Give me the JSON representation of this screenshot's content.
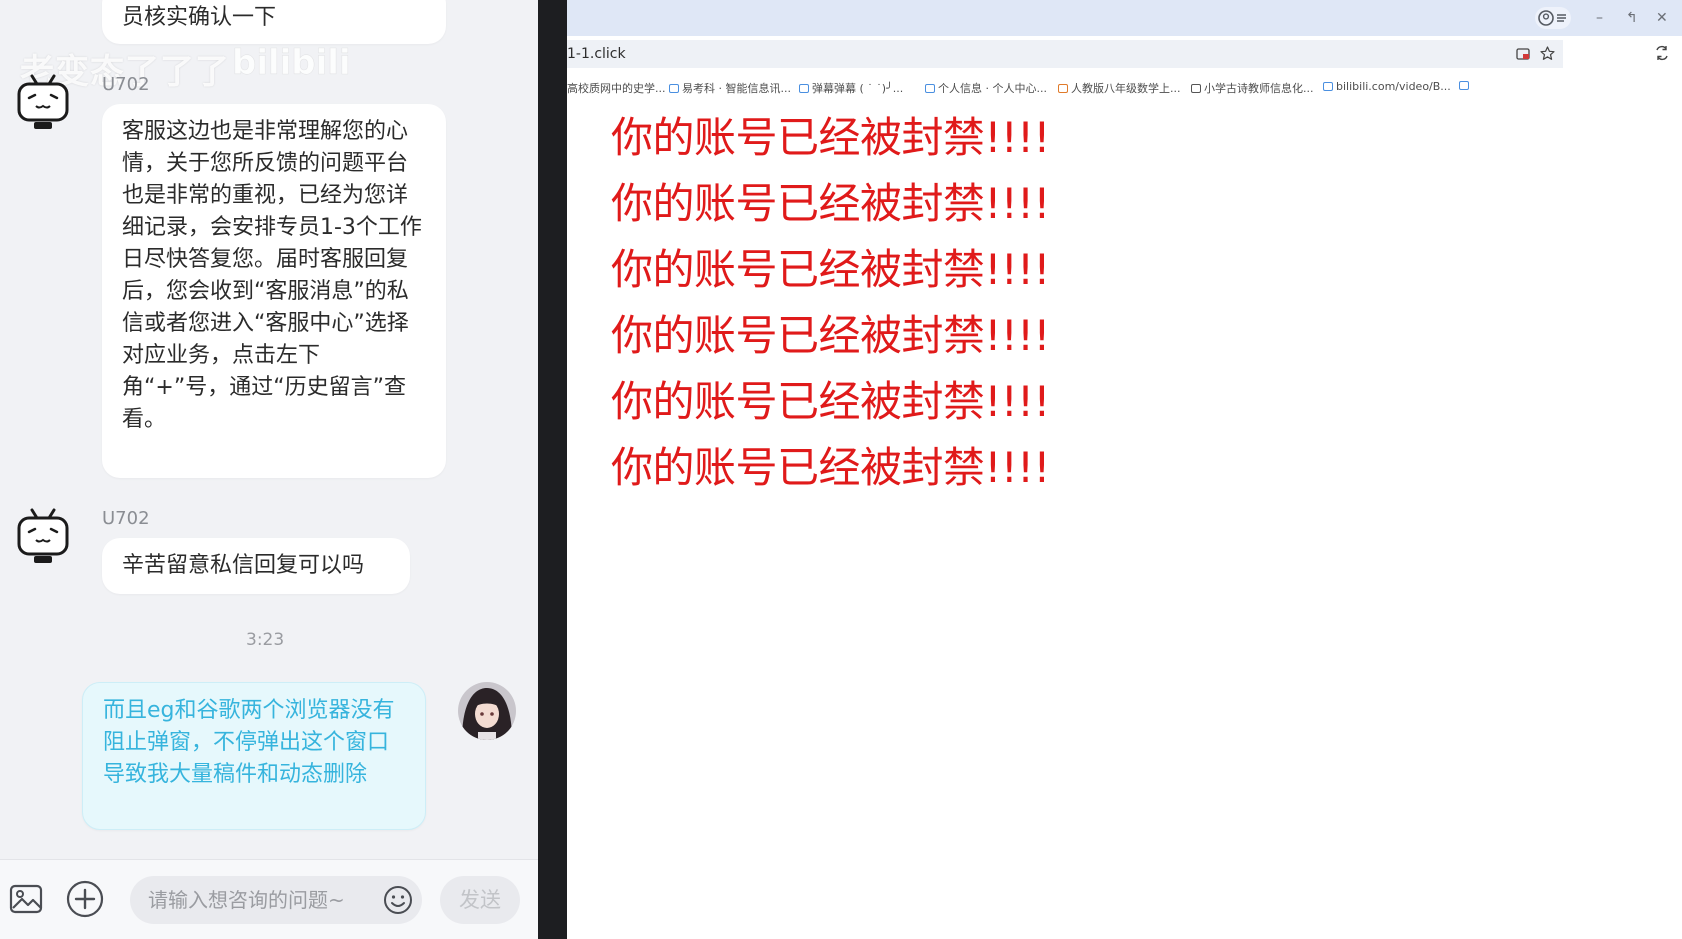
{
  "chat": {
    "watermark_text": "老变态了了了",
    "watermark_logo_text": "bilibili",
    "first_bubble_text": "员核实确认一下",
    "messages": [
      {
        "user": "U702",
        "text": "客服这边也是非常理解您的心情，关于您所反馈的问题平台也是非常的重视，已经为您详细记录，会安排专员1-3个工作日尽快答复您。届时客服回复后，您会收到“客服消息”的私信或者您进入“客服中心”选择对应业务，点击左下角“+”号，通过“历史留言”查看。"
      },
      {
        "user": "U702",
        "text": "辛苦留意私信回复可以吗"
      }
    ],
    "timestamp": "3:23",
    "my_message": "而且eg和谷歌两个浏览器没有阻止弹窗，不停弹出这个窗口导致我大量稿件和动态删除",
    "input_placeholder": "请输入想咨询的问题~",
    "send_label": "发送"
  },
  "browser": {
    "url": "1-1.click",
    "bookmarks": [
      "高校质网中的史学...",
      "易考科 · 智能信息讯...",
      "弹幕弹幕 ( ˙ ˙)╯...",
      "个人信息 · 个人中心...",
      "人教版八年级数学上...",
      "小学古诗教师信息化...",
      "bilibili.com/video/B..."
    ],
    "alert_lines": [
      "你的账号已经被封禁!!!!",
      "你的账号已经被封禁!!!!",
      "你的账号已经被封禁!!!!",
      "你的账号已经被封禁!!!!",
      "你的账号已经被封禁!!!!",
      "你的账号已经被封禁!!!!"
    ]
  },
  "icons": [
    "bilibili-bot-avatar",
    "user-avatar",
    "image-icon",
    "plus-icon",
    "emoji-icon",
    "profile-icon",
    "minimize-icon",
    "restore-icon",
    "close-icon",
    "bookmark-star-icon",
    "extension-icon"
  ],
  "colors": {
    "alert": "#e01a1a",
    "my_bubble_text": "#36b4dd",
    "chat_bg": "#f1f2f5"
  }
}
